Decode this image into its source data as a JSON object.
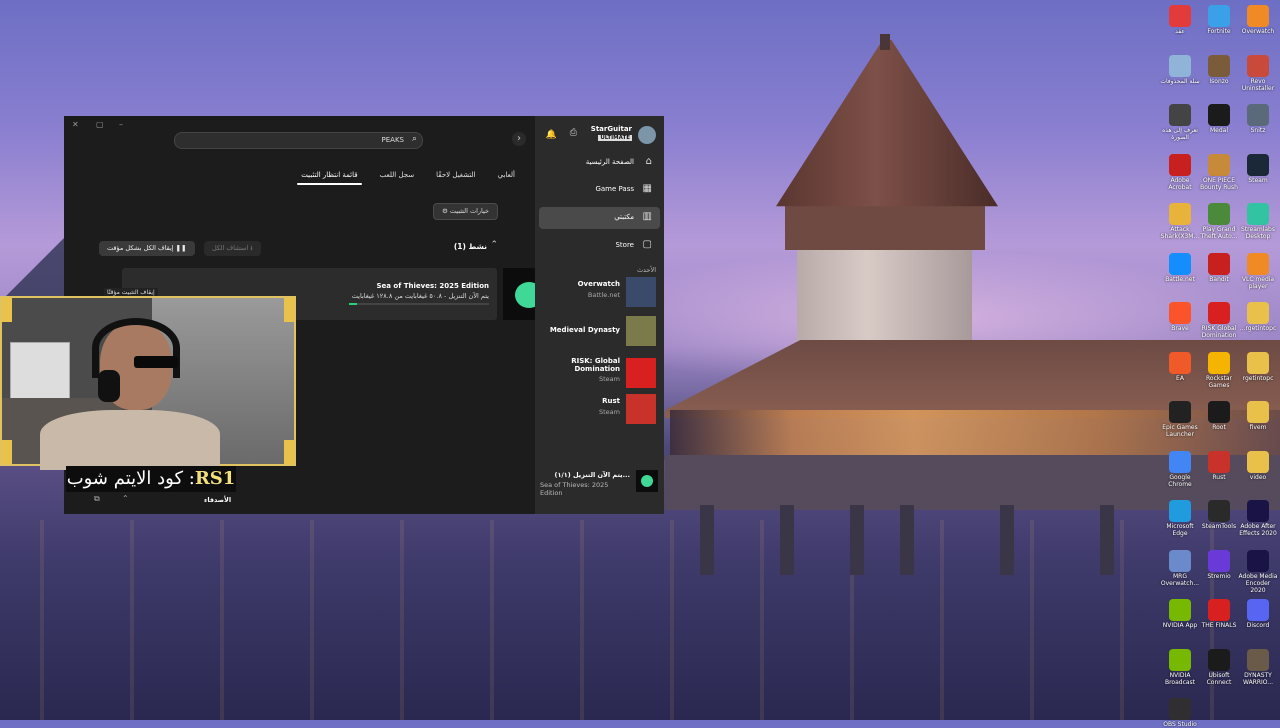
{
  "desktop": {
    "icons": [
      {
        "label": "عقد",
        "color": "#e23b3b"
      },
      {
        "label": "Fortnite",
        "color": "#3aa0e8"
      },
      {
        "label": "Overwatch",
        "color": "#f08a24"
      },
      {
        "label": "سلة المحذوفات",
        "color": "#8fb4d8"
      },
      {
        "label": "Isonzo",
        "color": "#7a5c3a"
      },
      {
        "label": "Revo Uninstaller",
        "color": "#c94a3a"
      },
      {
        "label": "تعرف إلى هذه الصورة",
        "color": "#444444"
      },
      {
        "label": "Medal",
        "color": "#1b1b1b"
      },
      {
        "label": "Snitz",
        "color": "#5a6a7a"
      },
      {
        "label": "Adobe Acrobat",
        "color": "#c8201f"
      },
      {
        "label": "ONE PIECE Bounty Rush",
        "color": "#c7893a"
      },
      {
        "label": "Steam",
        "color": "#1b2838"
      },
      {
        "label": "Attack Shark(X3M...",
        "color": "#e8b33a"
      },
      {
        "label": "Play Grand Theft Auto...",
        "color": "#4a8a3a"
      },
      {
        "label": "Streamlabs Desktop",
        "color": "#31c3a2"
      },
      {
        "label": "Battle.net",
        "color": "#148eff"
      },
      {
        "label": "Bandit",
        "color": "#c8201f"
      },
      {
        "label": "VLC media player",
        "color": "#f08a24"
      },
      {
        "label": "Brave",
        "color": "#fb542b"
      },
      {
        "label": "RISK Global Domination",
        "color": "#d82020"
      },
      {
        "label": "...rgetintopc",
        "color": "#e8c04a"
      },
      {
        "label": "EA",
        "color": "#f05a28"
      },
      {
        "label": "Rockstar Games",
        "color": "#f4b400"
      },
      {
        "label": "rgetintopc",
        "color": "#e8c04a"
      },
      {
        "label": "Epic Games Launcher",
        "color": "#222222"
      },
      {
        "label": "Root",
        "color": "#1b1b1b"
      },
      {
        "label": "fivem",
        "color": "#e8c04a"
      },
      {
        "label": "Google Chrome",
        "color": "#4285f4"
      },
      {
        "label": "Rust",
        "color": "#c8322a"
      },
      {
        "label": "video",
        "color": "#e8c04a"
      },
      {
        "label": "Microsoft Edge",
        "color": "#1f9bde"
      },
      {
        "label": "SteamTools",
        "color": "#2a2a2a"
      },
      {
        "label": "Adobe After Effects 2020",
        "color": "#1a1446"
      },
      {
        "label": "MRG Overwatch...",
        "color": "#6a8acb"
      },
      {
        "label": "Stremio",
        "color": "#6a3ad8"
      },
      {
        "label": "Adobe Media Encoder 2020",
        "color": "#1a1446"
      },
      {
        "label": "NVIDIA App",
        "color": "#76b900"
      },
      {
        "label": "THE FINALS",
        "color": "#d82020"
      },
      {
        "label": "Discord",
        "color": "#5865f2"
      },
      {
        "label": "NVIDIA Broadcast",
        "color": "#76b900"
      },
      {
        "label": "Ubisoft Connect",
        "color": "#1b1b1b"
      },
      {
        "label": "DYNASTY WARRIO...",
        "color": "#6a5a4a"
      },
      {
        "label": "OBS Studio",
        "color": "#302e31"
      }
    ]
  },
  "xbox": {
    "search": {
      "text": "PEAKS"
    },
    "tabs": [
      {
        "label": "ألعابي"
      },
      {
        "label": "التشغيل لاحقًا"
      },
      {
        "label": "سجل اللعب"
      },
      {
        "label": "قائمة انتظار التثبيت",
        "active": true
      }
    ],
    "install_options_label": "خيارات التثبيت",
    "active_section": "نشط (1)",
    "resume_all_label": "استئناف الكل",
    "pause_all_label": "إيقاف الكل بشكل مؤقت",
    "download": {
      "title": "Sea of Thieves: 2025 Edition",
      "status": "يتم الآن التنزيل - ٥٠.٨ غيغابايت من ١٢٨.٨ غيغابايت",
      "pause_tip": "إيقاف التثبيت مؤقتًا",
      "progress": 0.06
    },
    "sidebar": {
      "profile_name": "StarGuitar",
      "profile_badge": "ULTIMATE",
      "nav": [
        {
          "label": "الصفحة الرئيسية",
          "icon": "⌂"
        },
        {
          "label": "Game Pass",
          "icon": "▦"
        },
        {
          "label": "مكتبتي",
          "icon": "▥",
          "selected": true
        },
        {
          "label": "Store",
          "icon": "▢"
        }
      ],
      "recent_header": "الأحدث",
      "recent": [
        {
          "name": "Overwatch",
          "sub": "Battle.net",
          "color": "#3a4a6a"
        },
        {
          "name": "Medieval Dynasty",
          "sub": "",
          "color": "#7a7a4a"
        },
        {
          "name": "RISK: Global Domination",
          "sub": "Steam",
          "color": "#d82020"
        },
        {
          "name": "Rust",
          "sub": "Steam",
          "color": "#c8322a"
        }
      ],
      "queue_title": "يتم الآن التنزيل (١/١)...",
      "queue_sub": "Sea of Thieves: 2025 Edition"
    },
    "friends_label": "الأصدقاء"
  },
  "overlay": {
    "caption_prefix": "كود الايتم شوب :",
    "caption_code": "RS1"
  }
}
